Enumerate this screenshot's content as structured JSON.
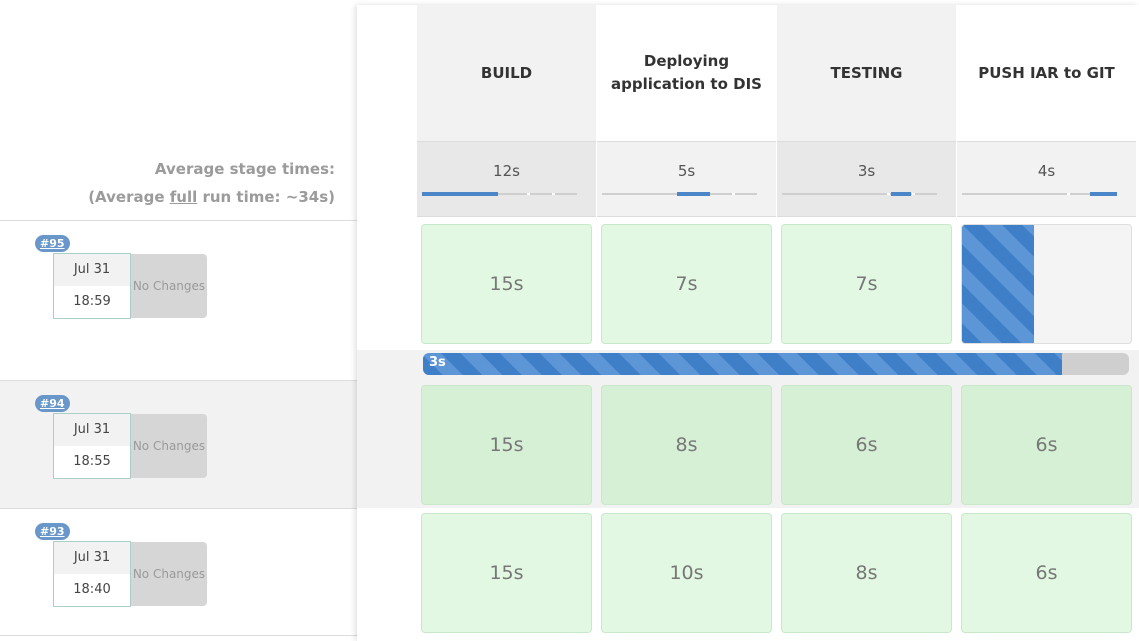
{
  "average": {
    "line1": "Average stage times:",
    "line2_prefix": "(Average ",
    "line2_underlined": "full",
    "line2_suffix": " run time: ~34s)"
  },
  "stages": [
    {
      "name": "BUILD",
      "avg_time": "12s",
      "avg_fraction": 0.5
    },
    {
      "name": "Deploying application to DIS",
      "avg_time": "5s",
      "avg_fraction": 0.21
    },
    {
      "name": "TESTING",
      "avg_time": "3s",
      "avg_fraction": 0.13
    },
    {
      "name": "PUSH IAR to GIT",
      "avg_time": "4s",
      "avg_fraction": 0.17
    }
  ],
  "builds": [
    {
      "number": "#95",
      "date": "Jul 31",
      "time": "18:59",
      "changes": "No Changes",
      "stage_times": [
        "15s",
        "7s",
        "7s",
        ""
      ],
      "running_stage_index": 3
    },
    {
      "number": "#94",
      "date": "Jul 31",
      "time": "18:55",
      "changes": "No Changes",
      "stage_times": [
        "15s",
        "8s",
        "6s",
        "6s"
      ]
    },
    {
      "number": "#93",
      "date": "Jul 31",
      "time": "18:40",
      "changes": "No Changes",
      "stage_times": [
        "15s",
        "10s",
        "8s",
        "6s"
      ]
    }
  ],
  "progress": {
    "label": "3s",
    "fraction": 0.905
  },
  "colors": {
    "accent": "#4a86c8",
    "success": "#e2f8e2",
    "badge": "#6a97c9"
  }
}
